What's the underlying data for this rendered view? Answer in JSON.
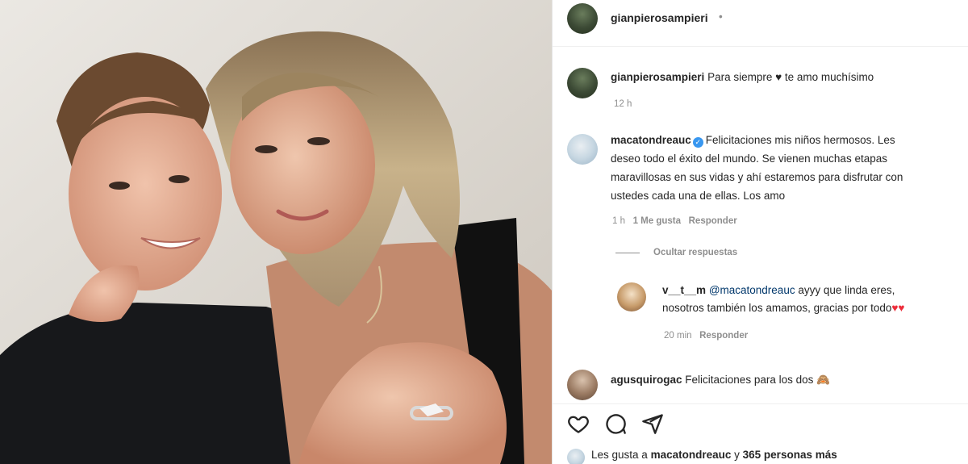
{
  "post": {
    "author": "gianpierosampieri",
    "follow_dot": "•",
    "caption_text": "Para siempre",
    "caption_heart": "♥",
    "caption_rest": "te amo muchísimo",
    "caption_time": "12 h"
  },
  "comments": [
    {
      "user": "macatondreauc",
      "verified": true,
      "lines": [
        "Felicitaciones mis niños hermosos. Les",
        "deseo todo el éxito del mundo. Se vienen muchas etapas",
        "maravillosas en sus vidas y ahí estaremos para disfrutar con",
        "ustedes cada una de ellas. Los amo"
      ],
      "time": "1 h",
      "likes": "1 Me gusta",
      "reply_label": "Responder",
      "hide_replies": "Ocultar respuestas"
    },
    {
      "user": "v__t__m",
      "mention": "@macatondreauc",
      "line1": "ayyy que linda eres,",
      "line2": "nosotros también los amamos, gracias por todo",
      "hearts": "♥♥",
      "time": "20 min",
      "reply_label": "Responder"
    },
    {
      "user": "agusquirogac",
      "text": "Felicitaciones para los dos",
      "emoji": "🙈"
    }
  ],
  "actions": {
    "like_icon": "heart-outline-icon",
    "comment_icon": "comment-bubble-icon",
    "share_icon": "paper-plane-icon"
  },
  "likes": {
    "prefix": "Les gusta a",
    "user": "macatondreauc",
    "middle": "y",
    "count": "365 personas más"
  },
  "colors": {
    "verified_blue": "#3897f0",
    "heart_red": "#ed2d3b",
    "muted_text": "#8e8e8e"
  }
}
